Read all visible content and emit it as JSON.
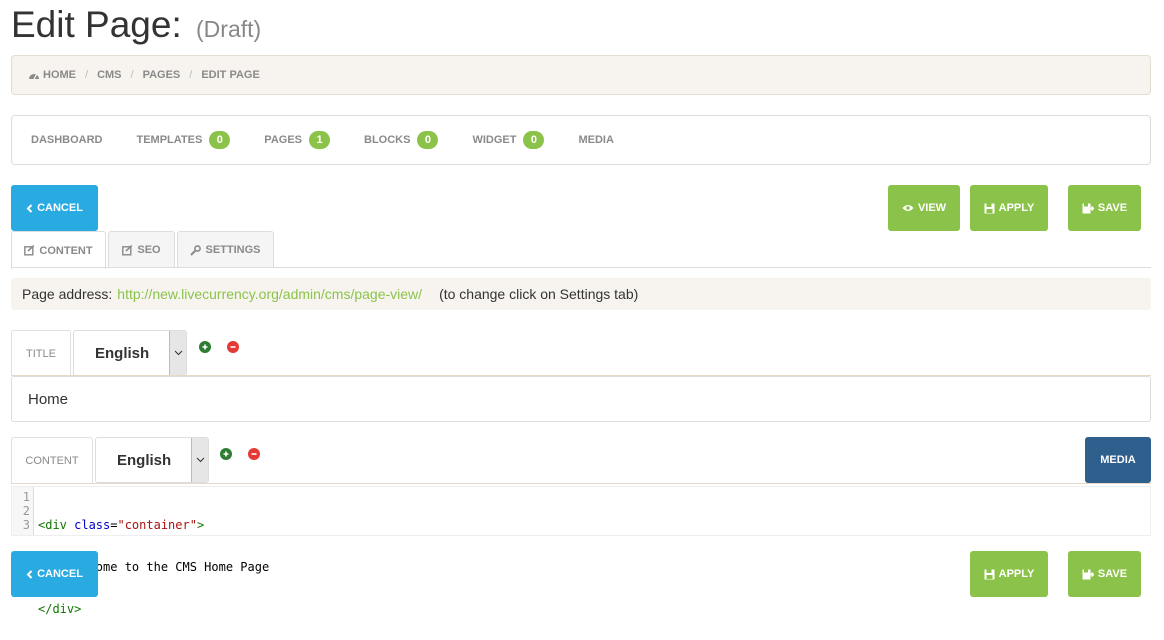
{
  "header": {
    "title": "Edit Page:",
    "status": "(Draft)"
  },
  "breadcrumb": {
    "items": [
      "HOME",
      "CMS",
      "PAGES",
      "EDIT PAGE"
    ]
  },
  "nav": {
    "items": [
      {
        "label": "DASHBOARD"
      },
      {
        "label": "TEMPLATES",
        "badge": "0"
      },
      {
        "label": "PAGES",
        "badge": "1"
      },
      {
        "label": "BLOCKS",
        "badge": "0"
      },
      {
        "label": "WIDGET",
        "badge": "0"
      },
      {
        "label": "MEDIA"
      }
    ]
  },
  "toolbar": {
    "cancel_label": "CANCEL",
    "view_label": "VIEW",
    "apply_label": "APPLY",
    "save_label": "SAVE"
  },
  "tabs": [
    {
      "label": "CONTENT",
      "icon": "edit-icon"
    },
    {
      "label": "SEO",
      "icon": "edit-icon"
    },
    {
      "label": "SETTINGS",
      "icon": "wrench-icon"
    }
  ],
  "address": {
    "label": "Page address:",
    "url": "http://new.livecurrency.org/admin/cms/page-view/",
    "hint": "(to change click on Settings tab)"
  },
  "title_field": {
    "label": "TITLE",
    "language": "English",
    "value": "Home"
  },
  "content_field": {
    "label": "CONTENT",
    "language": "English",
    "media_label": "MEDIA",
    "code_lines": [
      {
        "num": "1",
        "open": "<div ",
        "attr": "class",
        "eq": "=",
        "str": "\"container\"",
        "close": ">"
      },
      {
        "num": "2",
        "text": "    Welcome to the CMS Home Page"
      },
      {
        "num": "3",
        "tag": "</div>"
      }
    ]
  },
  "bottom_toolbar": {
    "cancel_label": "CANCEL",
    "apply_label": "APPLY",
    "save_label": "SAVE"
  },
  "colors": {
    "primary_blue": "#29abe2",
    "accent_green": "#8bc34a",
    "media_navy": "#2f5f8d",
    "panel_beige": "#f7f4ef"
  }
}
